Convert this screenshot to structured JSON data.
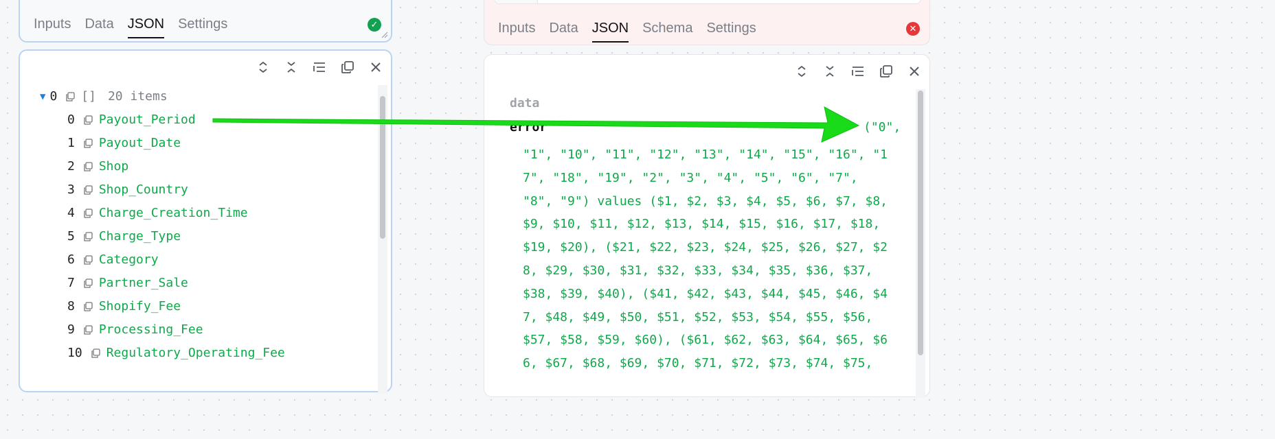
{
  "left_node": {
    "tabs": [
      {
        "label": "Inputs",
        "active": false
      },
      {
        "label": "Data",
        "active": false
      },
      {
        "label": "JSON",
        "active": true
      },
      {
        "label": "Settings",
        "active": false
      }
    ],
    "status": "success",
    "status_color": "#12a150"
  },
  "right_node": {
    "tabs": [
      {
        "label": "Inputs",
        "active": false
      },
      {
        "label": "Data",
        "active": false
      },
      {
        "label": "JSON",
        "active": true
      },
      {
        "label": "Schema",
        "active": false
      },
      {
        "label": "Settings",
        "active": false
      }
    ],
    "status": "error",
    "status_color": "#e5383b"
  },
  "left_panel": {
    "toolbar_icons": [
      "expand-all-icon",
      "collapse-all-icon",
      "format-icon",
      "copy-icon",
      "close-icon"
    ],
    "root": {
      "index": "0",
      "type_marker": "[]",
      "count_label": "20 items"
    },
    "items": [
      {
        "index": "0",
        "key": "Payout_Period"
      },
      {
        "index": "1",
        "key": "Payout_Date"
      },
      {
        "index": "2",
        "key": "Shop"
      },
      {
        "index": "3",
        "key": "Shop_Country"
      },
      {
        "index": "4",
        "key": "Charge_Creation_Time"
      },
      {
        "index": "5",
        "key": "Charge_Type"
      },
      {
        "index": "6",
        "key": "Category"
      },
      {
        "index": "7",
        "key": "Partner_Sale"
      },
      {
        "index": "8",
        "key": "Shopify_Fee"
      },
      {
        "index": "9",
        "key": "Processing_Fee"
      },
      {
        "index": "10",
        "key": "Regulatory_Operating_Fee"
      }
    ]
  },
  "right_panel": {
    "toolbar_icons": [
      "expand-all-icon",
      "collapse-all-icon",
      "format-icon",
      "copy-icon",
      "close-icon"
    ],
    "data_label": "data",
    "error_key": "error",
    "error_head": "(\"0\",",
    "error_lines": [
      "\"1\", \"10\", \"11\", \"12\", \"13\", \"14\", \"15\", \"16\", \"1",
      "7\", \"18\", \"19\", \"2\", \"3\", \"4\", \"5\", \"6\", \"7\",",
      "\"8\", \"9\") values ($1, $2, $3, $4, $5, $6, $7, $8,",
      "$9, $10, $11, $12, $13, $14, $15, $16, $17, $18,",
      "$19, $20), ($21, $22, $23, $24, $25, $26, $27, $2",
      "8, $29, $30, $31, $32, $33, $34, $35, $36, $37,",
      "$38, $39, $40), ($41, $42, $43, $44, $45, $46, $4",
      "7, $48, $49, $50, $51, $52, $53, $54, $55, $56,",
      "$57, $58, $59, $60), ($61, $62, $63, $64, $65, $6",
      "6, $67, $68, $69, $70, $71, $72, $73, $74, $75,"
    ]
  },
  "annotation": {
    "arrow_color": "#1adb1a"
  }
}
